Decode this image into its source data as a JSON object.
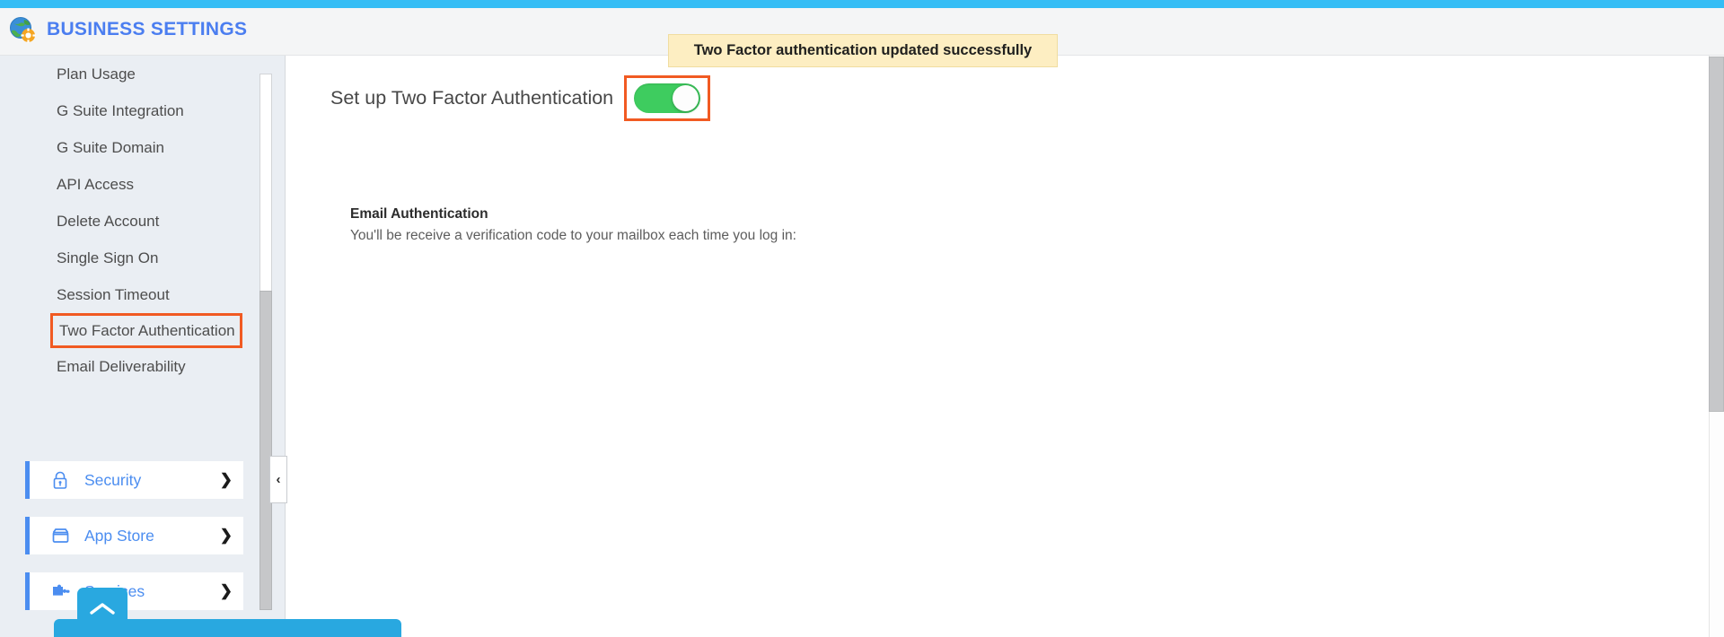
{
  "theme": {
    "accent_bar_color": "#35bdf5",
    "brand_color": "#4b7ef0",
    "link_color": "#4b8df0",
    "annotation_color": "#f15a22",
    "toggle_on_color": "#3ecc5f",
    "toast_bg_color": "#fdeec2",
    "sidebar_bg_color": "#eaeef3",
    "bottom_bar_color": "#29a8e0"
  },
  "header": {
    "title": "BUSINESS SETTINGS",
    "logo_icon": "globe-gear-icon"
  },
  "toast": {
    "message": "Two Factor authentication updated successfully"
  },
  "sidebar": {
    "items": [
      {
        "label": "Plan Usage",
        "highlighted": false
      },
      {
        "label": "G Suite Integration",
        "highlighted": false
      },
      {
        "label": "G Suite Domain",
        "highlighted": false
      },
      {
        "label": "API Access",
        "highlighted": false
      },
      {
        "label": "Delete Account",
        "highlighted": false
      },
      {
        "label": "Single Sign On",
        "highlighted": false
      },
      {
        "label": "Session Timeout",
        "highlighted": false
      },
      {
        "label": "Two Factor Authentication",
        "highlighted": true
      },
      {
        "label": "Email Deliverability",
        "highlighted": false
      }
    ],
    "categories": [
      {
        "label": "Security",
        "icon": "lock-icon",
        "chevron": "❯"
      },
      {
        "label": "App Store",
        "icon": "store-icon",
        "chevron": "❯"
      },
      {
        "label": "Services",
        "icon": "puzzle-piece-icon",
        "chevron": "❯"
      }
    ],
    "collapse_handle_glyph": "‹"
  },
  "main": {
    "setup_label": "Set up Two Factor Authentication",
    "toggle": {
      "name": "two-factor-authentication-toggle",
      "state": "on"
    },
    "email_section": {
      "title": "Email Authentication",
      "description": "You'll be receive a verification code to your mailbox each time you log in:"
    }
  }
}
